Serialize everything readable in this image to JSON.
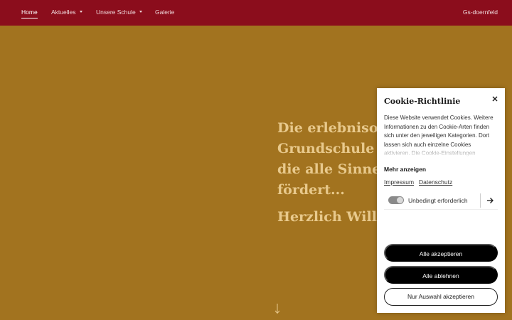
{
  "nav": {
    "items": [
      {
        "label": "Home",
        "active": true,
        "has_dropdown": false
      },
      {
        "label": "Aktuelles",
        "active": false,
        "has_dropdown": true
      },
      {
        "label": "Unsere Schule",
        "active": false,
        "has_dropdown": true
      },
      {
        "label": "Galerie",
        "active": false,
        "has_dropdown": false
      }
    ],
    "site_name": "Gs-doernfeld"
  },
  "hero": {
    "lines": [
      "Die erlebnisori",
      "Grundschule in",
      "die alle Sinne v",
      "fördert..."
    ],
    "welcome": "Herzlich Willko",
    "scroll_icon": "arrow-down-icon"
  },
  "cookie": {
    "title": "Cookie-Richtlinie",
    "close_icon": "close-icon",
    "description": "Diese Website verwendet Cookies. Weitere Informationen zu den Cookie-Arten finden sich unter den jeweiligen Kategorien. Dort lassen sich auch einzelne Cookies aktivieren. Die Cookie-Einstellungen",
    "more_label": "Mehr anzeigen",
    "links": [
      "Impressum",
      "Datenschutz"
    ],
    "category": {
      "label": "Unbedingt erforderlich",
      "enabled": true,
      "icon": "arrow-right-icon"
    },
    "buttons": {
      "accept_all": "Alle akzeptieren",
      "reject_all": "Alle ablehnen",
      "accept_selection": "Nur Auswahl akzeptieren"
    }
  },
  "colors": {
    "nav_bg": "#8b0d1c",
    "page_bg": "#a2731f",
    "hero_text": "#e8c98c",
    "button_dark": "#000000"
  }
}
